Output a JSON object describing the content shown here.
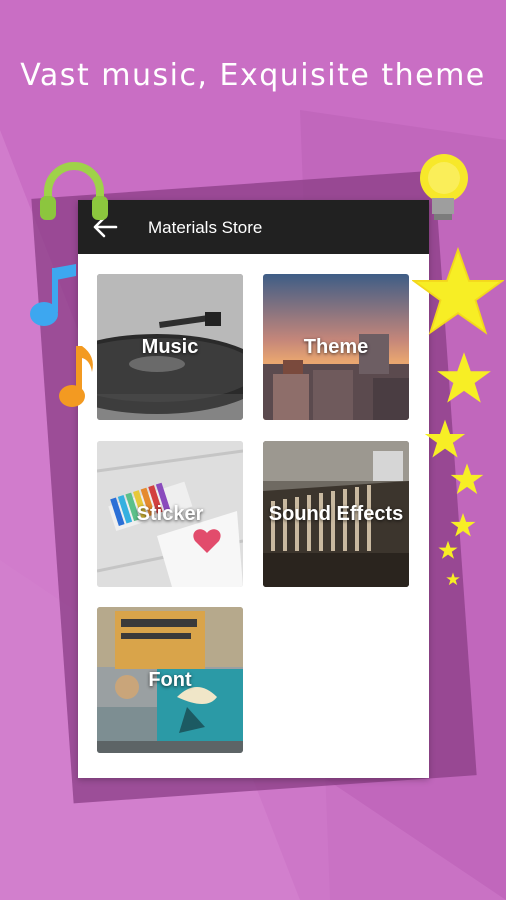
{
  "headline": "Vast music, Exquisite theme",
  "appbar": {
    "title": "Materials Store"
  },
  "tiles": [
    {
      "label": "Music"
    },
    {
      "label": "Theme"
    },
    {
      "label": "Sticker"
    },
    {
      "label": "Sound Effects"
    },
    {
      "label": "Font"
    }
  ],
  "colors": {
    "background": "#c96ec4",
    "appbar": "#212121",
    "star": "#f7ee25"
  }
}
